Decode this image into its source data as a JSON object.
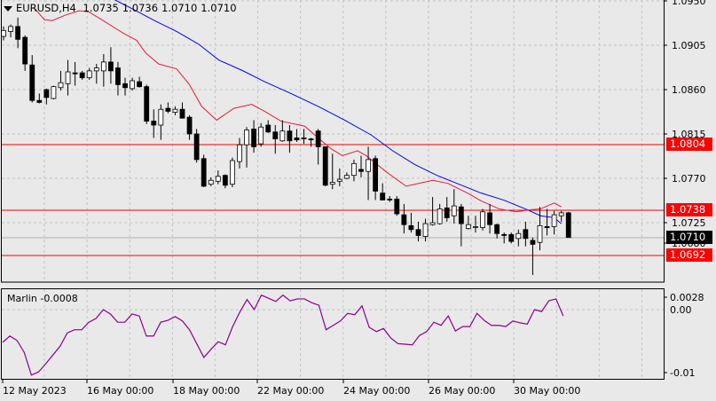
{
  "header": {
    "symbol": "EURUSD,H4",
    "open": "1.0735",
    "high": "1.0736",
    "low": "1.0710",
    "close": "1.0710"
  },
  "indicator": {
    "name": "Marlin",
    "value": "-0.0008",
    "scale_labels": [
      "0.0028",
      "0.00",
      "-0.01"
    ]
  },
  "price_axis": {
    "ticks": [
      "1.0950",
      "1.0905",
      "1.0860",
      "1.0815",
      "1.0770",
      "1.0725",
      "1.0680"
    ]
  },
  "levels": [
    {
      "label": "1.0804",
      "color": "#ff0000"
    },
    {
      "label": "1.0738",
      "color": "#ff0000"
    },
    {
      "label": "1.0692",
      "color": "#ff0000"
    }
  ],
  "current_price": {
    "label": "1.0710",
    "color": "#000000"
  },
  "time_axis": [
    "12 May 2023",
    "16 May 00:00",
    "18 May 00:00",
    "22 May 00:00",
    "24 May 00:00",
    "26 May 00:00",
    "30 May 00:00"
  ],
  "colors": {
    "background": "#e9e9e9",
    "ma_fast": "#e8193c",
    "ma_slow": "#0000ff",
    "oscillator": "#8b008b",
    "level": "#ff0000"
  },
  "chart_data": {
    "type": "candlestick",
    "symbol": "EURUSD",
    "timeframe": "H4",
    "ylim": [
      1.066,
      1.095
    ],
    "ohlc": [
      [
        1.0914,
        1.0924,
        1.091,
        1.092
      ],
      [
        1.0919,
        1.0926,
        1.0913,
        1.0924
      ],
      [
        1.0924,
        1.0933,
        1.0902,
        1.0911
      ],
      [
        1.0913,
        1.0915,
        1.0879,
        1.0886
      ],
      [
        1.0885,
        1.0895,
        1.0847,
        1.0849
      ],
      [
        1.0849,
        1.0856,
        1.0846,
        1.0847
      ],
      [
        1.086,
        1.0861,
        1.0845,
        1.0852
      ],
      [
        1.0851,
        1.0864,
        1.085,
        1.0863
      ],
      [
        1.0862,
        1.0879,
        1.0859,
        1.0867
      ],
      [
        1.0866,
        1.089,
        1.0854,
        1.0878
      ],
      [
        1.0877,
        1.0888,
        1.0864,
        1.0876
      ],
      [
        1.0877,
        1.0879,
        1.087,
        1.0872
      ],
      [
        1.0872,
        1.0882,
        1.087,
        1.0879
      ],
      [
        1.0879,
        1.0886,
        1.0866,
        1.0882
      ],
      [
        1.0879,
        1.0896,
        1.0863,
        1.0888
      ],
      [
        1.0888,
        1.0903,
        1.0866,
        1.0879
      ],
      [
        1.0882,
        1.0888,
        1.0854,
        1.0865
      ],
      [
        1.0866,
        1.0872,
        1.0854,
        1.0862
      ],
      [
        1.0861,
        1.0872,
        1.0859,
        1.0869
      ],
      [
        1.0868,
        1.0873,
        1.0862,
        1.0863
      ],
      [
        1.0863,
        1.0865,
        1.0825,
        1.0828
      ],
      [
        1.0828,
        1.084,
        1.0811,
        1.0824
      ],
      [
        1.0824,
        1.0845,
        1.0809,
        1.084
      ],
      [
        1.0841,
        1.0847,
        1.0836,
        1.0838
      ],
      [
        1.0837,
        1.0843,
        1.0834,
        1.084
      ],
      [
        1.084,
        1.0847,
        1.0831,
        1.0831
      ],
      [
        1.0832,
        1.0834,
        1.0809,
        1.0815
      ],
      [
        1.0815,
        1.082,
        1.0786,
        1.0789
      ],
      [
        1.079,
        1.0794,
        1.0761,
        1.0762
      ],
      [
        1.0764,
        1.0771,
        1.0762,
        1.0768
      ],
      [
        1.0767,
        1.0778,
        1.0764,
        1.0772
      ],
      [
        1.0773,
        1.0774,
        1.076,
        1.0763
      ],
      [
        1.0764,
        1.0791,
        1.0761,
        1.0788
      ],
      [
        1.0787,
        1.0811,
        1.078,
        1.0804
      ],
      [
        1.0804,
        1.0822,
        1.0781,
        1.0819
      ],
      [
        1.082,
        1.0829,
        1.0796,
        1.0802
      ],
      [
        1.0805,
        1.0826,
        1.0802,
        1.0822
      ],
      [
        1.0824,
        1.0829,
        1.0816,
        1.0817
      ],
      [
        1.0817,
        1.0824,
        1.0795,
        1.081
      ],
      [
        1.0808,
        1.0829,
        1.0807,
        1.0818
      ],
      [
        1.0818,
        1.0824,
        1.0796,
        1.0808
      ],
      [
        1.0811,
        1.082,
        1.0807,
        1.0809
      ],
      [
        1.0811,
        1.082,
        1.0805,
        1.081
      ],
      [
        1.081,
        1.0811,
        1.0802,
        1.0809
      ],
      [
        1.0818,
        1.082,
        1.0784,
        1.0802
      ],
      [
        1.0802,
        1.0802,
        1.0762,
        1.0763
      ],
      [
        1.0764,
        1.0795,
        1.0759,
        1.0766
      ],
      [
        1.0767,
        1.078,
        1.0762,
        1.0769
      ],
      [
        1.077,
        1.0776,
        1.0769,
        1.0773
      ],
      [
        1.0773,
        1.0789,
        1.0767,
        1.0785
      ],
      [
        1.0779,
        1.0793,
        1.0771,
        1.0777
      ],
      [
        1.0777,
        1.0802,
        1.0748,
        1.0789
      ],
      [
        1.079,
        1.0793,
        1.0748,
        1.0757
      ],
      [
        1.0755,
        1.0765,
        1.0748,
        1.0748
      ],
      [
        1.0749,
        1.0752,
        1.0746,
        1.0748
      ],
      [
        1.0749,
        1.0752,
        1.0732,
        1.0734
      ],
      [
        1.0733,
        1.0744,
        1.0714,
        1.0723
      ],
      [
        1.0722,
        1.0735,
        1.0715,
        1.0718
      ],
      [
        1.0718,
        1.0726,
        1.0706,
        1.0712
      ],
      [
        1.0711,
        1.0729,
        1.0706,
        1.0724
      ],
      [
        1.0723,
        1.0751,
        1.0722,
        1.0725
      ],
      [
        1.0724,
        1.0744,
        1.0723,
        1.0739
      ],
      [
        1.074,
        1.0751,
        1.0726,
        1.073
      ],
      [
        1.0732,
        1.0759,
        1.0724,
        1.0742
      ],
      [
        1.0741,
        1.0744,
        1.0701,
        1.0724
      ],
      [
        1.0719,
        1.0732,
        1.0718,
        1.0723
      ],
      [
        1.072,
        1.0732,
        1.0715,
        1.0721
      ],
      [
        1.072,
        1.0739,
        1.0717,
        1.0736
      ],
      [
        1.0735,
        1.0744,
        1.0714,
        1.0723
      ],
      [
        1.0723,
        1.0724,
        1.0709,
        1.0714
      ],
      [
        1.0713,
        1.0715,
        1.0704,
        1.0712
      ],
      [
        1.0713,
        1.0715,
        1.0704,
        1.0706
      ],
      [
        1.0709,
        1.0718,
        1.0701,
        1.0714
      ],
      [
        1.0718,
        1.0726,
        1.0701,
        1.0709
      ],
      [
        1.0707,
        1.071,
        1.0672,
        1.0703
      ],
      [
        1.0705,
        1.0741,
        1.0697,
        1.0722
      ],
      [
        1.0721,
        1.0739,
        1.0712,
        1.072
      ],
      [
        1.0721,
        1.0737,
        1.0713,
        1.0733
      ],
      [
        1.0732,
        1.0737,
        1.0726,
        1.0735
      ],
      [
        1.0735,
        1.0736,
        1.071,
        1.071
      ]
    ],
    "ma_fast": [
      [
        4.4,
        1.0942
      ],
      [
        5.7,
        1.0931
      ],
      [
        6.8,
        1.093
      ],
      [
        8.8,
        1.0936
      ],
      [
        10.6,
        1.094
      ],
      [
        11.9,
        1.0939
      ],
      [
        13.7,
        1.0931
      ],
      [
        16.8,
        1.0917
      ],
      [
        18.6,
        1.091
      ],
      [
        19.9,
        1.0897
      ],
      [
        21.7,
        1.0886
      ],
      [
        24.2,
        1.0881
      ],
      [
        26.0,
        1.0865
      ],
      [
        27.7,
        1.0843
      ],
      [
        29.8,
        1.0829
      ],
      [
        32.2,
        1.0841
      ],
      [
        34.7,
        1.0845
      ],
      [
        36.5,
        1.0838
      ],
      [
        38.8,
        1.0828
      ],
      [
        42.1,
        1.0823
      ],
      [
        44.0,
        1.0811
      ],
      [
        45.8,
        1.08
      ],
      [
        47.4,
        1.0793
      ],
      [
        49.5,
        1.0798
      ],
      [
        50.7,
        1.0793
      ],
      [
        53.8,
        1.0775
      ],
      [
        56.3,
        1.0762
      ],
      [
        60.0,
        1.0768
      ],
      [
        62.1,
        1.0765
      ],
      [
        64.9,
        1.0755
      ],
      [
        66.8,
        1.0747
      ],
      [
        69.3,
        1.0739
      ],
      [
        71.7,
        1.0736
      ],
      [
        73.6,
        1.0738
      ],
      [
        75.1,
        1.0739
      ],
      [
        77.0,
        1.0745
      ],
      [
        78.0,
        1.0741
      ]
    ],
    "ma_slow": [
      [
        15.6,
        1.0951
      ],
      [
        18.0,
        1.0942
      ],
      [
        21.1,
        1.093
      ],
      [
        24.2,
        1.0919
      ],
      [
        27.3,
        1.0906
      ],
      [
        30.1,
        1.089
      ],
      [
        33.5,
        1.0879
      ],
      [
        36.5,
        1.0868
      ],
      [
        40.2,
        1.0856
      ],
      [
        44.0,
        1.0843
      ],
      [
        47.7,
        1.0829
      ],
      [
        51.4,
        1.0814
      ],
      [
        54.4,
        1.0798
      ],
      [
        57.5,
        1.0784
      ],
      [
        60.6,
        1.0773
      ],
      [
        63.7,
        1.0764
      ],
      [
        66.8,
        1.0755
      ],
      [
        69.9,
        1.0748
      ],
      [
        72.96,
        1.0739
      ],
      [
        75.1,
        1.0732
      ],
      [
        77.0,
        1.073
      ],
      [
        78.0,
        1.0724
      ]
    ],
    "marlin": [
      -0.0052,
      -0.0042,
      -0.0049,
      -0.0068,
      -0.0104,
      -0.0099,
      -0.0086,
      -0.0072,
      -0.0058,
      -0.0037,
      -0.0032,
      -0.0032,
      -0.002,
      -0.0014,
      0.0,
      -0.0007,
      -0.002,
      -0.002,
      -0.0007,
      -0.001,
      -0.0042,
      -0.0042,
      -0.002,
      -0.0017,
      -0.0011,
      -0.0018,
      -0.0032,
      -0.0054,
      -0.0076,
      -0.0063,
      -0.0051,
      -0.0056,
      -0.0027,
      -0.0004,
      0.0016,
      0.0,
      0.0023,
      0.0018,
      0.0013,
      0.0023,
      0.0014,
      0.0017,
      0.0017,
      0.0011,
      0.0007,
      -0.0032,
      -0.0025,
      -0.0018,
      -0.0006,
      -0.0008,
      0.0006,
      -0.0028,
      -0.0035,
      -0.003,
      -0.0045,
      -0.0054,
      -0.0055,
      -0.0056,
      -0.0041,
      -0.0035,
      -0.002,
      -0.0025,
      -0.001,
      -0.0034,
      -0.0027,
      -0.0027,
      -0.0006,
      -0.0017,
      -0.0025,
      -0.0025,
      -0.0027,
      -0.0018,
      -0.0021,
      -0.0023,
      0.0,
      -0.0003,
      0.0014,
      0.0017,
      -0.001
    ]
  }
}
